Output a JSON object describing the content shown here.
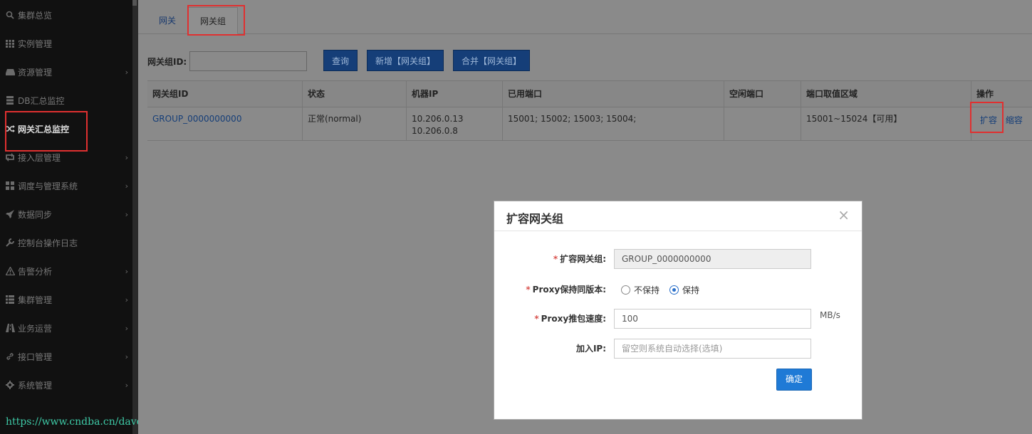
{
  "sidebar": {
    "items": [
      {
        "label": "集群总览",
        "icon": "search-icon",
        "chevron": false
      },
      {
        "label": "实例管理",
        "icon": "grid-icon",
        "chevron": false
      },
      {
        "label": "资源管理",
        "icon": "drive-icon",
        "chevron": true
      },
      {
        "label": "DB汇总监控",
        "icon": "server-icon",
        "chevron": false
      },
      {
        "label": "网关汇总监控",
        "icon": "shuffle-icon",
        "chevron": false,
        "active": true
      },
      {
        "label": "接入层管理",
        "icon": "retweet-icon",
        "chevron": true
      },
      {
        "label": "调度与管理系统",
        "icon": "dashboard-icon",
        "chevron": true
      },
      {
        "label": "数据同步",
        "icon": "rocket-icon",
        "chevron": true
      },
      {
        "label": "控制台操作日志",
        "icon": "wrench-icon",
        "chevron": false
      },
      {
        "label": "告警分析",
        "icon": "warning-icon",
        "chevron": true
      },
      {
        "label": "集群管理",
        "icon": "list-icon",
        "chevron": true
      },
      {
        "label": "业务运营",
        "icon": "road-icon",
        "chevron": true
      },
      {
        "label": "接口管理",
        "icon": "link-icon",
        "chevron": true
      },
      {
        "label": "系统管理",
        "icon": "gear-icon",
        "chevron": true
      }
    ]
  },
  "watermark": "https://www.cndba.cn/dave",
  "tabs": [
    {
      "label": "网关",
      "active": false
    },
    {
      "label": "网关组",
      "active": true
    }
  ],
  "filter": {
    "label": "网关组ID:",
    "value": "",
    "buttons": {
      "query": "查询",
      "add": "新增【网关组】",
      "merge": "合并【网关组】"
    }
  },
  "table": {
    "headers": [
      "网关组ID",
      "状态",
      "机器IP",
      "已用端口",
      "空闲端口",
      "端口取值区域",
      "操作"
    ],
    "rows": [
      {
        "id": "GROUP_0000000000",
        "status": "正常(normal)",
        "ip1": "10.206.0.13",
        "ip2": "10.206.0.8",
        "used_ports": "15001; 15002; 15003; 15004;",
        "free_ports": "",
        "port_range": "15001~15024【可用】",
        "action_expand": "扩容",
        "action_shrink": "缩容"
      }
    ]
  },
  "modal": {
    "title": "扩容网关组",
    "close": "×",
    "fields": {
      "group_label": "扩容网关组:",
      "group_value": "GROUP_0000000000",
      "proxy_version_label": "Proxy保持同版本:",
      "option_no": "不保持",
      "option_yes": "保持",
      "selected_option": "保持",
      "speed_label": "Proxy推包速度:",
      "speed_value": "100",
      "speed_unit": "MB/s",
      "ip_label": "加入IP:",
      "ip_placeholder": "留空则系统自动选择(选填)",
      "required_mark": "*"
    },
    "confirm": "确定"
  },
  "colors": {
    "sidebar_bg": "#111111",
    "highlight": "#e03030",
    "primary_button": "#1f7ad6",
    "link": "#153e78",
    "watermark": "#3ec9a6"
  }
}
